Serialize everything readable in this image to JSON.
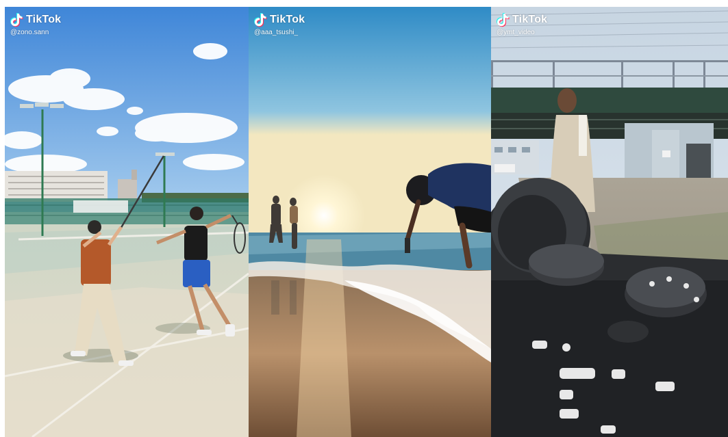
{
  "panels": [
    {
      "id": "tennis",
      "brand": "TikTok",
      "handle": "@zono.sann",
      "logo_icon": "tiktok-note-icon"
    },
    {
      "id": "beach",
      "brand": "TikTok",
      "handle": "@aaa_tsushi_",
      "logo_icon": "tiktok-note-icon"
    },
    {
      "id": "camera",
      "brand": "TikTok",
      "handle": "@ymt_video",
      "logo_icon": "tiktok-note-icon"
    }
  ],
  "colors": {
    "watermark": "#ffffff",
    "tiktok_cyan": "#25F4EE",
    "tiktok_red": "#FE2C55"
  }
}
